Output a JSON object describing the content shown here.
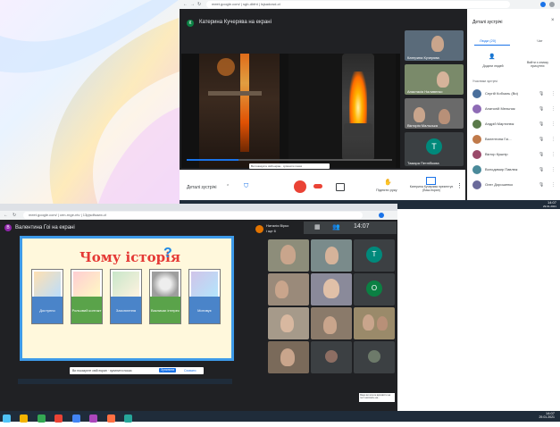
{
  "top_window": {
    "url": "meet.google.com/ | sgb-dbfnt | lsjsadcwd-ct",
    "presenter_bar": "Катерина Кучерява на екрані",
    "presenter_initial": "К",
    "self_tile_name": "Катерина Кучерява",
    "tile_names": [
      "Катерина Кучерява",
      "Анастасія Наливенко",
      "Вікторія Мальська",
      "Тамара Петлібкова"
    ],
    "tile_initial": "Т",
    "screen_share_notice": "Ви показуєте свій екран · зупинити показ",
    "stop_sharing": "Зупинити",
    "meeting_details": "Деталі зустрічі",
    "you_presenting": "Катерина Кучерява презентує (Ваш екран)",
    "raise_hand": "Підняти руку",
    "side_panel": {
      "title": "Деталі зустрічі",
      "tab_people": "Люди (20)",
      "tab_chat": "Чат",
      "add_people": "Додати людей",
      "who_joined": "Вийти з списку присутніх",
      "section": "Учасники зустрічі",
      "people": [
        {
          "name": "Сергій Кобзаль (Ви)",
          "color": "#4a6f9c"
        },
        {
          "name": "Анатолій Мельник",
          "color": "#8e6bb5"
        },
        {
          "name": "Андрій Мартинюк",
          "color": "#5a7a4a"
        },
        {
          "name": "Валентина Гоі...",
          "color": "#c07a4a"
        },
        {
          "name": "Віктор Кушнір",
          "color": "#9a4a6a"
        },
        {
          "name": "Володимир Павлюк",
          "color": "#4a8a9a"
        },
        {
          "name": "Олег Дорошенко",
          "color": "#6a6a9a"
        }
      ]
    }
  },
  "bottom_window": {
    "url": "meet.google.com/ | cen-rnge-ntv | 13pjsdfsawx-cf",
    "presenter_name": "Валентина Гоі на екрані",
    "presenter_initial": "В",
    "self_name": "Наталія Вірко",
    "self_sub": "і ще 6",
    "clock": "14:07",
    "slide": {
      "title": "Чому історія",
      "badge": "?",
      "cards": [
        {
          "label": "Доступно",
          "color": "#4a84c9"
        },
        {
          "label": "Рольовий контакт",
          "color": "#5aa34a"
        },
        {
          "label": "Захоплення",
          "color": "#4a84c9"
        },
        {
          "label": "Викликає інтерес",
          "color": "#5aa34a"
        },
        {
          "label": "Мотивує",
          "color": "#4a84c9"
        }
      ],
      "notice": "Ви показуєте свій екран · зупинити показ",
      "notice_btn": "Зупинити",
      "notice_hide": "Сховати"
    },
    "grid_initials": [
      "Т",
      "О"
    ],
    "grid_initial_colors": [
      "#00897b",
      "#0b8043"
    ],
    "toast": "Якщо ви хочете відповісти на тест натисніть на..."
  },
  "taskbar_top": {
    "time": "14:07",
    "date": "29.01.2021"
  },
  "taskbar_bottom": {
    "time": "14:07",
    "date": "29.01.2021"
  }
}
